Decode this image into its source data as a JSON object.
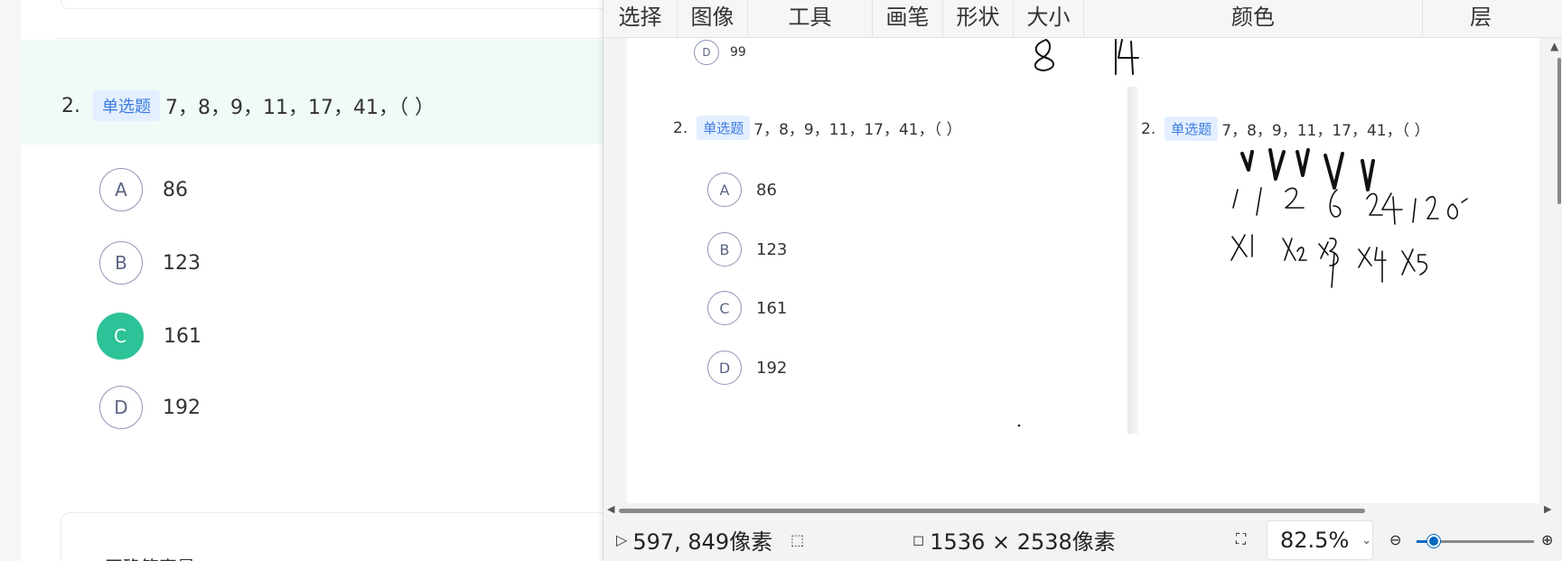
{
  "left_page": {
    "question": {
      "number": "2.",
      "type_tag": "单选题",
      "text": "7，8，9，11，17，41，（ ）"
    },
    "options": [
      {
        "letter": "A",
        "value": "86",
        "selected": false
      },
      {
        "letter": "B",
        "value": "123",
        "selected": false
      },
      {
        "letter": "C",
        "value": "161",
        "selected": true
      },
      {
        "letter": "D",
        "value": "192",
        "selected": false
      }
    ],
    "bottom_partial_text": "正确答案是"
  },
  "viewer": {
    "menu": [
      "选择",
      "图像",
      "工具",
      "画笔",
      "形状",
      "大小",
      "颜色",
      "层"
    ],
    "canvas": {
      "prev_option": {
        "letter": "D",
        "value": "99"
      },
      "left_copy": {
        "number": "2.",
        "type_tag": "单选题",
        "text": "7，8，9，11，17，41，（ ）",
        "options": [
          {
            "letter": "A",
            "value": "86"
          },
          {
            "letter": "B",
            "value": "123"
          },
          {
            "letter": "C",
            "value": "161"
          },
          {
            "letter": "D",
            "value": "192"
          }
        ]
      },
      "right_copy": {
        "number": "2.",
        "type_tag": "单选题",
        "text": "7，8，9，11，17，41，（ ）"
      },
      "handwriting": {
        "top_partial": "8 14",
        "row1": "1 1 2 6 24 120",
        "row2": "×1 ×2 ×3 ×4 ×5"
      }
    },
    "status": {
      "cursor_position": "597, 849像素",
      "image_size": "1536 × 2538像素",
      "zoom": "82.5%"
    },
    "accent_color": "#0067c0",
    "selected_color": "#2dc297",
    "icons": [
      "pointer-icon",
      "selection-icon",
      "crop-icon",
      "fit-screen-icon",
      "chevron-down-icon",
      "zoom-out-icon",
      "zoom-in-icon"
    ]
  }
}
